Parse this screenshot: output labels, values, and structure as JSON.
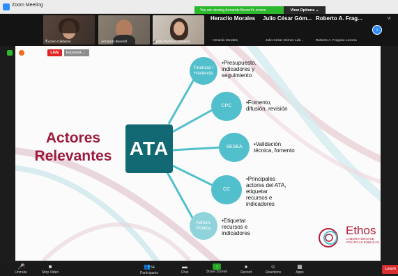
{
  "window": {
    "title": "Zoom Meeting"
  },
  "banner": {
    "viewing": "You are viewing Armando Becerril's screen",
    "view_options": "View Options ⌄"
  },
  "participants": {
    "tiles": [
      {
        "name": "Lucero Calderón"
      },
      {
        "name": "Armando Becerril"
      },
      {
        "name": "Jaña Pacheco Valtierra"
      }
    ],
    "name_tiles": [
      {
        "big": "Heraclio Morales",
        "small": "Heraclio Morales"
      },
      {
        "big": "Julio César Góm...",
        "small": "Julio César Gómez Lab..."
      },
      {
        "big": "Roberto A. Frag...",
        "small": "Roberto A. Fragoso Lecona"
      }
    ],
    "side_label": "Vi"
  },
  "stream": {
    "live": "LIVE",
    "platform": "Facebook ⌄"
  },
  "slide": {
    "title_line1": "Actores",
    "title_line2": "Relevantes",
    "center": "ATA",
    "nodes": [
      {
        "label": "Finanzas / Hacienda",
        "desc": "•Presupuesto,\nindicadores y\nseguimiento"
      },
      {
        "label": "CPC",
        "desc": "•Fomento,\ndifusión, revisión"
      },
      {
        "label": "SESEA",
        "desc": "•Validación\ntécnica, fomento"
      },
      {
        "label": "CC",
        "desc": "•Principales\nactores del ATA,\netiquetar\nrecursos e\nindicadores"
      },
      {
        "label": "Admón. Pública",
        "desc": "•Etiquetar\nrecursos e\nindicadores"
      }
    ],
    "logo": {
      "name": "Ethos",
      "subtitle": "LABORATORIO DE POLÍTICAS PÚBLICAS"
    }
  },
  "toolbar": {
    "unmute": "Unmute",
    "stop_video": "Stop Video",
    "participants": "Participants",
    "participants_count": "54",
    "chat": "Chat",
    "share_screen": "Share Screen",
    "record": "Record",
    "reactions": "Reactions",
    "apps": "Apps",
    "leave": "Leave"
  },
  "colors": {
    "accent": "#2d8cff",
    "brand": "#9c1b3c",
    "node": "#52bfcc",
    "center": "#136973",
    "banner": "#2eb82e"
  }
}
